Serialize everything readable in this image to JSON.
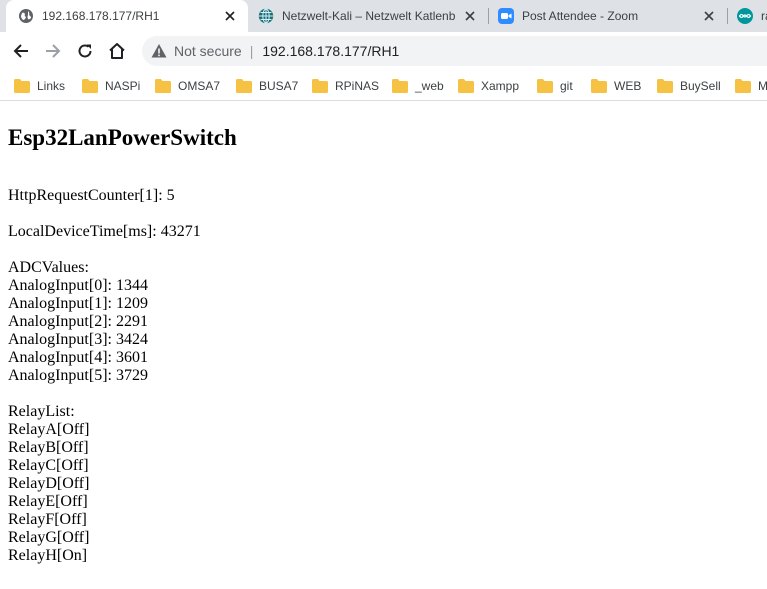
{
  "tabs": [
    {
      "title": "192.168.178.177/RH1",
      "active": true
    },
    {
      "title": "Netzwelt-Kali – Netzwelt Katlenb"
    },
    {
      "title": "Post Attendee - Zoom"
    },
    {
      "title": "ra"
    }
  ],
  "toolbar": {
    "security_label": "Not secure",
    "url": "192.168.178.177/RH1"
  },
  "bookmarks": [
    "Links",
    "NASPi",
    "OMSA7",
    "BUSA7",
    "RPiNAS",
    "_web",
    "Xampp",
    "git",
    "WEB",
    "BuySell",
    "M"
  ],
  "page": {
    "heading": "Esp32LanPowerSwitch",
    "http_counter": "HttpRequestCounter[1]: 5",
    "local_time": "LocalDeviceTime[ms]: 43271",
    "adc_header": "ADCValues:",
    "adc_values": [
      "AnalogInput[0]: 1344",
      "AnalogInput[1]: 1209",
      "AnalogInput[2]: 2291",
      "AnalogInput[3]: 3424",
      "AnalogInput[4]: 3601",
      "AnalogInput[5]: 3729"
    ],
    "relay_header": "RelayList:",
    "relays": [
      "RelayA[Off]",
      "RelayB[Off]",
      "RelayC[Off]",
      "RelayD[Off]",
      "RelayE[Off]",
      "RelayF[Off]",
      "RelayG[Off]",
      "RelayH[On]"
    ]
  },
  "colors": {
    "tabstrip": "#dee1e6",
    "omnibox": "#f1f3f4",
    "folder": "#f5c243",
    "zoom": "#2d8cff",
    "arduino": "#00979c"
  }
}
